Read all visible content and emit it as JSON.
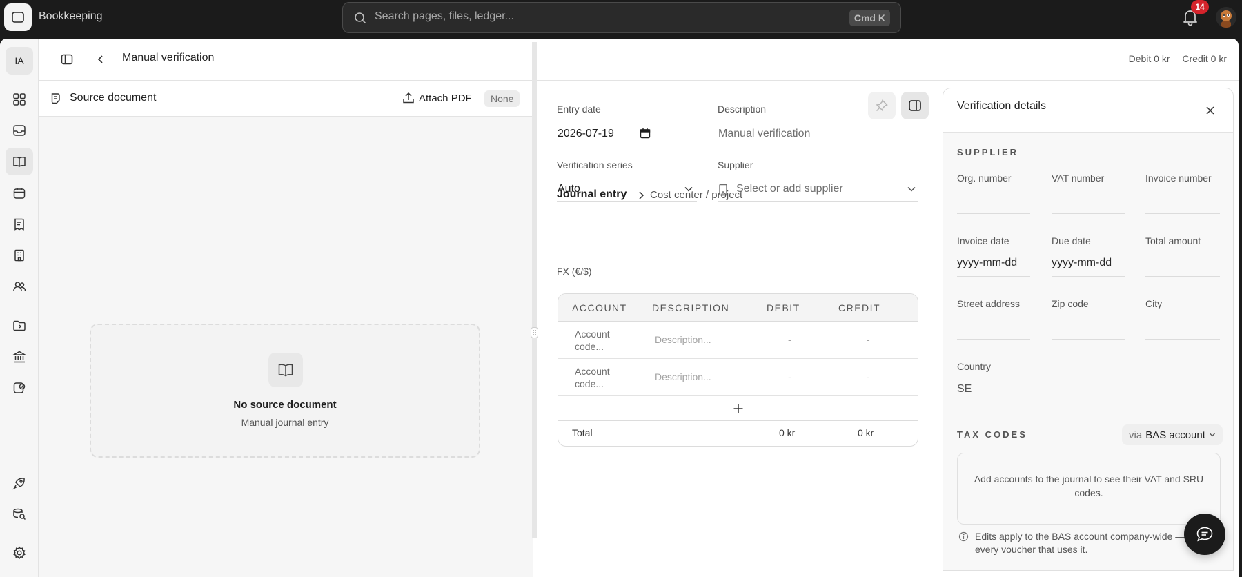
{
  "app": {
    "name": "Bookkeeping"
  },
  "search": {
    "placeholder": "Search pages, files, ledger...",
    "shortcut": "Cmd K"
  },
  "notifications": {
    "count": "14"
  },
  "rail": {
    "workspace_initials": "IA",
    "items": [
      "dashboard-icon",
      "inbox-icon",
      "book-icon",
      "calendar-icon",
      "receipt-icon",
      "building-icon",
      "users-icon",
      "folder-icon",
      "bank-icon",
      "wallet-icon",
      "rocket-icon",
      "search-data-icon",
      "settings-icon"
    ]
  },
  "header": {
    "title": "Manual verification",
    "debit": "Debit 0 kr",
    "credit": "Credit 0 kr"
  },
  "doc": {
    "title": "Source document",
    "attach_label": "Attach PDF",
    "status": "None",
    "empty_title": "No source document",
    "empty_subtitle": "Manual journal entry"
  },
  "form": {
    "entry_date_label": "Entry date",
    "entry_date_value": "2026-07-19",
    "description_label": "Description",
    "description_value": "Manual verification",
    "series_label": "Verification series",
    "series_value": "Auto",
    "supplier_label": "Supplier",
    "supplier_placeholder": "Select or add supplier"
  },
  "subnav": {
    "active": "Journal entry",
    "item": "Cost center / project"
  },
  "fx_label": "FX (€/$)",
  "journal": {
    "headers": {
      "account": "ACCOUNT",
      "description": "DESCRIPTION",
      "debit": "DEBIT",
      "credit": "CREDIT"
    },
    "rows": [
      {
        "account": "Account code...",
        "description": "Description...",
        "debit": "-",
        "credit": "-"
      },
      {
        "account": "Account code...",
        "description": "Description...",
        "debit": "-",
        "credit": "-"
      }
    ],
    "total_label": "Total",
    "total_debit": "0 kr",
    "total_credit": "0 kr"
  },
  "details": {
    "title": "Verification details",
    "supplier_section": "SUPPLIER",
    "org_number": "Org. number",
    "vat_number": "VAT number",
    "invoice_number": "Invoice number",
    "invoice_date": "Invoice date",
    "due_date": "Due date",
    "total_amount": "Total amount",
    "date_placeholder": "yyyy-mm-dd",
    "street_address": "Street address",
    "zip_code": "Zip code",
    "city": "City",
    "country_label": "Country",
    "country_value": "SE",
    "tax_section": "TAX CODES",
    "via_prefix": "via",
    "via_value": "BAS account",
    "tax_info": "Add accounts to the journal to see their VAT and SRU codes.",
    "note": "Edits apply to the BAS account company-wide — every voucher that uses it."
  },
  "colors": {
    "topbar": "#1b1b1b",
    "badge": "#d4232b",
    "rail": "#f6f6f6"
  }
}
